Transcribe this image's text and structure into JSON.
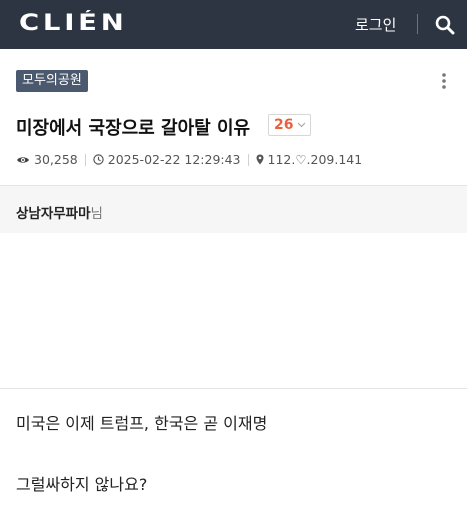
{
  "header": {
    "logo": "CLIÉN",
    "login_label": "로그인",
    "background_color": "#2d3543"
  },
  "post": {
    "category": "모두의공원",
    "title": "미장에서 국장으로 갈아탈 이유",
    "comment_count": "26",
    "views": "30,258",
    "datetime": "2025-02-22 12:29:43",
    "ip": "112.♡.209.141",
    "author_name": "상남자무파마",
    "author_suffix": "님",
    "body_lines": [
      "미국은 이제 트럼프, 한국은 곧 이재명",
      "그럴싸하지 않나요?"
    ]
  },
  "colors": {
    "category_bg": "#4b596e",
    "comment_accent": "#e8613c",
    "author_bar_bg": "#f6f6f6"
  },
  "icons": {
    "search": "search-icon",
    "more": "more-vertical-icon",
    "views": "eye-icon",
    "time": "clock-icon",
    "ip": "location-pin-icon",
    "comment_dropdown": "chevron-down-icon"
  }
}
